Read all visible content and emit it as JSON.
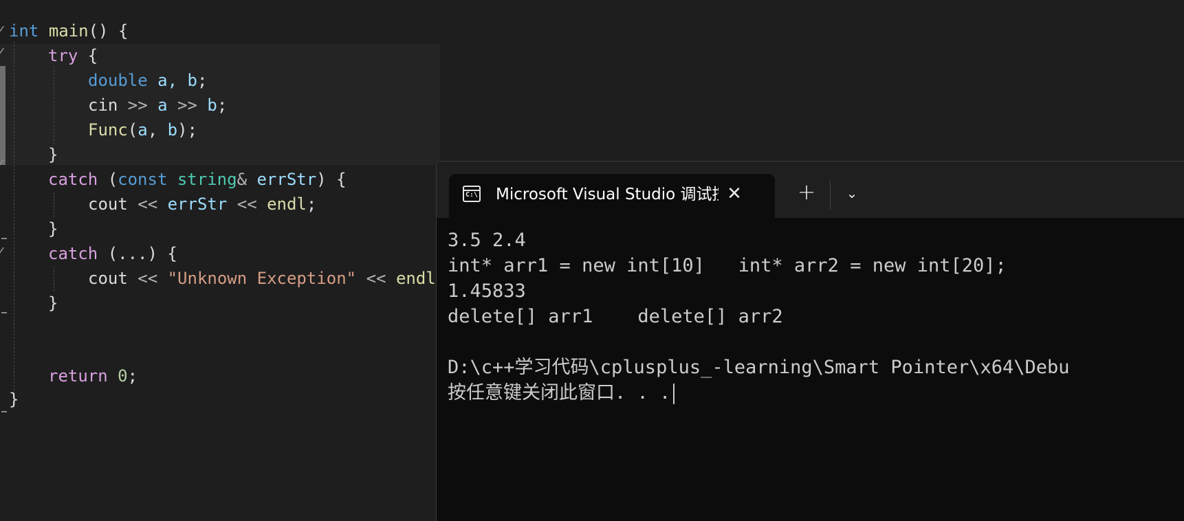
{
  "editor": {
    "lines": {
      "l1": {
        "kw": "int",
        "fn": "main",
        "rest": "() {"
      },
      "l2": {
        "ctl": "try",
        "rest": " {"
      },
      "l3": {
        "kw": "double",
        "vars": "a, b",
        "rest": ";"
      },
      "l4": {
        "pl": "cin",
        "op1": " >> ",
        "v1": "a",
        "op2": " >> ",
        "v2": "b",
        "rest": ";"
      },
      "l5": {
        "fn": "Func",
        "p1": "(",
        "v1": "a",
        "p2": ", ",
        "v2": "b",
        "rest": ");"
      },
      "l6": {
        "text": "}"
      },
      "l7": {
        "ctl": "catch",
        "p1": " (",
        "kw": "const",
        "sp": " ",
        "typ": "string",
        "amp": "&",
        "sp2": " ",
        "var": "errStr",
        "rest": ") {"
      },
      "l8": {
        "pl": "cout",
        "op1": " << ",
        "var": "errStr",
        "op2": " << ",
        "fn": "endl",
        "rest": ";"
      },
      "l9": {
        "text": "}"
      },
      "l10": {
        "ctl": "catch",
        "rest": " (...) {"
      },
      "l11": {
        "pl": "cout",
        "op1": " << ",
        "str": "\"Unknown Exception\"",
        "op2": " << ",
        "fn": "endl"
      },
      "l12": {
        "text": "}"
      },
      "l15": {
        "ctl": "return",
        "sp": " ",
        "num": "0",
        "rest": ";"
      },
      "l16": {
        "text": "}"
      }
    }
  },
  "terminal": {
    "tab": {
      "icon": "console-icon",
      "icon_glyph": "C:\\",
      "title": "Microsoft Visual Studio 调试控制台",
      "close": "✕"
    },
    "new_tab": "+",
    "dropdown": "⌄",
    "output": [
      "3.5 2.4",
      "int* arr1 = new int[10]   int* arr2 = new int[20];",
      "1.45833",
      "delete[] arr1    delete[] arr2",
      "",
      "D:\\c++学习代码\\cplusplus_-learning\\Smart Pointer\\x64\\Debu",
      "按任意键关闭此窗口. . ."
    ]
  }
}
